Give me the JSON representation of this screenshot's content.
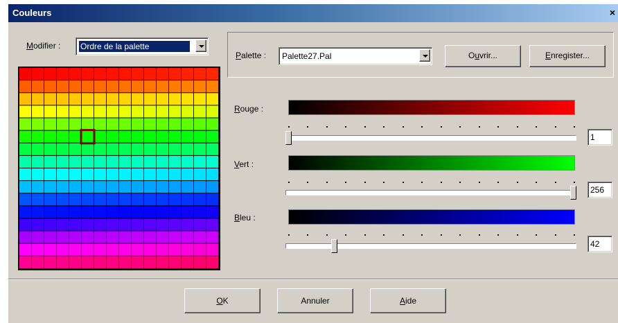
{
  "dialog": {
    "title": "Couleurs",
    "close_glyph": "×"
  },
  "modifier": {
    "label_mnemonic": "M",
    "label_rest": "odifier :",
    "selected": "Ordre de la palette"
  },
  "palette": {
    "label_mnemonic": "P",
    "label_rest": "alette :",
    "selected": "Palette27.Pal",
    "open_pre": "O",
    "open_mnemonic": "u",
    "open_post": "vrir...",
    "save_mnemonic": "E",
    "save_rest": "nregister..."
  },
  "grid": {
    "rows": 16,
    "cols": 16,
    "selected_row": 5,
    "selected_col": 5,
    "row_hues": [
      0,
      22,
      45,
      60,
      90,
      115,
      135,
      160,
      178,
      195,
      220,
      235,
      255,
      280,
      300,
      325,
      340,
      355
    ],
    "selection_color": "#800000"
  },
  "sliders": {
    "red": {
      "label_mnemonic": "R",
      "label_rest": "ouge :",
      "value": "1",
      "level": 0.0,
      "bar_from": "#000000",
      "bar_to": "#ff0000"
    },
    "green": {
      "label_mnemonic": "V",
      "label_rest": "ert :",
      "value": "256",
      "level": 1.0,
      "bar_from": "#000000",
      "bar_to": "#00ff00"
    },
    "blue": {
      "label_mnemonic": "B",
      "label_rest": "leu :",
      "value": "42",
      "level": 0.16,
      "bar_from": "#000000",
      "bar_to": "#0000ff"
    }
  },
  "buttons": {
    "ok_mnemonic": "O",
    "ok_rest": "K",
    "cancel": "Annuler",
    "help_mnemonic": "A",
    "help_rest": "ide"
  }
}
